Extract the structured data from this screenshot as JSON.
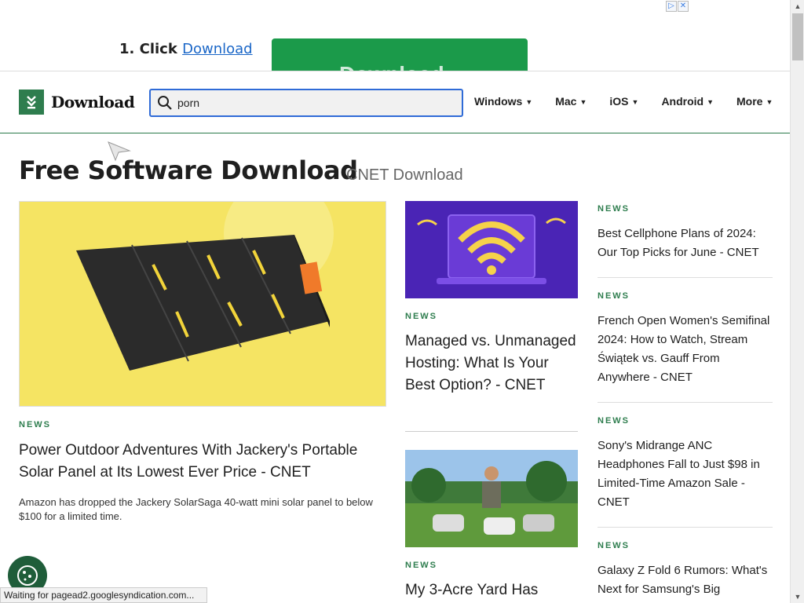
{
  "ad": {
    "step_prefix": "1. Click",
    "step_link": "Download",
    "button_text": "Download"
  },
  "header": {
    "logo_text": "Download",
    "search_value": "porn",
    "nav": [
      {
        "label": "Windows"
      },
      {
        "label": "Mac"
      },
      {
        "label": "iOS"
      },
      {
        "label": "Android"
      },
      {
        "label": "More"
      }
    ]
  },
  "page": {
    "title": "Free Software Download",
    "subtitle": "CNET Download"
  },
  "lead": {
    "tag": "NEWS",
    "headline": "Power Outdoor Adventures With Jackery's Portable Solar Panel at Its Lowest Ever Price - CNET",
    "description": "Amazon has dropped the Jackery SolarSaga 40-watt mini solar panel to below $100 for a limited time."
  },
  "middle": [
    {
      "tag": "NEWS",
      "headline": "Managed vs. Unmanaged Hosting: What Is Your Best Option? - CNET"
    },
    {
      "tag": "NEWS",
      "headline": "My 3-Acre Yard Has"
    }
  ],
  "right": [
    {
      "tag": "NEWS",
      "headline": "Best Cellphone Plans of 2024: Our Top Picks for June - CNET"
    },
    {
      "tag": "NEWS",
      "headline": "French Open Women's Semifinal 2024: How to Watch, Stream Świątek vs. Gauff From Anywhere - CNET"
    },
    {
      "tag": "NEWS",
      "headline": "Sony's Midrange ANC Headphones Fall to Just $98 in Limited-Time Amazon Sale - CNET"
    },
    {
      "tag": "NEWS",
      "headline": "Galaxy Z Fold 6 Rumors: What's Next for Samsung's Big"
    }
  ],
  "status_bar": "Waiting for pagead2.googlesyndication.com...",
  "colors": {
    "brand_green": "#2e7d4e",
    "search_border": "#2f6bd7"
  }
}
